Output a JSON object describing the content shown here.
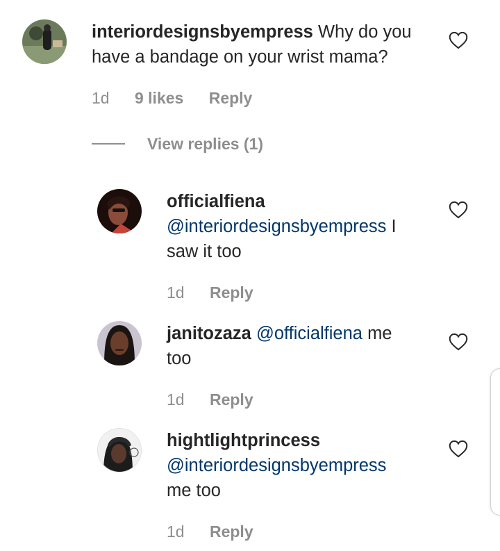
{
  "comments": [
    {
      "username": "interiordesignsbyempress",
      "text": "Why do you have a bandage on your wrist mama?",
      "time": "1d",
      "likes": "9 likes",
      "reply_label": "Reply"
    }
  ],
  "view_replies": "View replies (1)",
  "replies": [
    {
      "username": "officialfiena",
      "mention": "@interiordesignsbyempress",
      "text_line1_tail": "I",
      "text_line2": "saw it too",
      "time": "1d",
      "reply_label": "Reply"
    },
    {
      "username": "janitozaza",
      "mention": "@officialfiena",
      "text_line1_tail": "me",
      "text_line2": "too",
      "time": "1d",
      "reply_label": "Reply"
    },
    {
      "username": "hightlightprincess",
      "mention": "@interiordesignsbyempress",
      "text_line2": "me too",
      "time": "1d",
      "reply_label": "Reply"
    }
  ],
  "colors": {
    "text": "#262626",
    "meta": "#8e8e8e",
    "mention": "#00376b"
  },
  "icons": [
    "heart-icon"
  ]
}
